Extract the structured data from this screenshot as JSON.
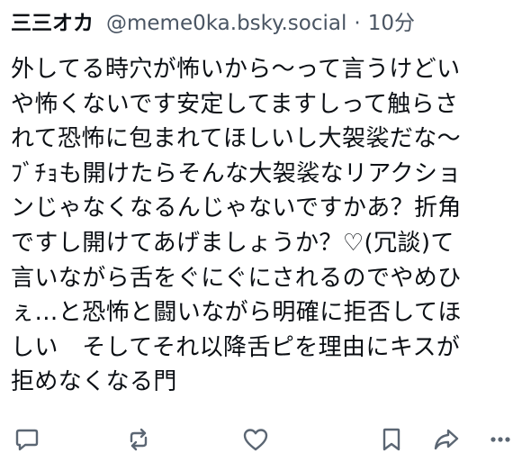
{
  "post": {
    "display_name": "三三オカ",
    "handle": "@meme0ka.bsky.social",
    "separator": "·",
    "time": "10分",
    "lines": [
      "外してる時穴が怖いから〜って言うけどい",
      "や怖くないです安定してますしって触らさ",
      "れて恐怖に包まれてほしいし大袈裟だな〜",
      "ﾌﾞﾁｮも開けたらそんな大袈裟なリアクショ",
      "ンじゃなくなるんじゃないですかあ？折角",
      "ですし開けてあげましょうか？♡(冗談)て",
      "言いながら舌をぐにぐにされるのでやめひ",
      "ぇ…と恐怖と闘いながら明確に拒否してほ",
      "しい　そしてそれ以降舌ピを理由にキスが",
      "拒めなくなる門"
    ]
  },
  "actions": {
    "reply_icon": "speech-bubble-icon",
    "repost_icon": "repost-arrows-icon",
    "like_icon": "heart-outline-icon",
    "bookmark_icon": "bookmark-icon",
    "share_icon": "share-arrow-icon",
    "more_icon": "ellipsis-icon"
  },
  "colors": {
    "text": "#0b0f14",
    "secondary": "#4a5563",
    "icon": "#5b6673",
    "background": "#ffffff"
  }
}
